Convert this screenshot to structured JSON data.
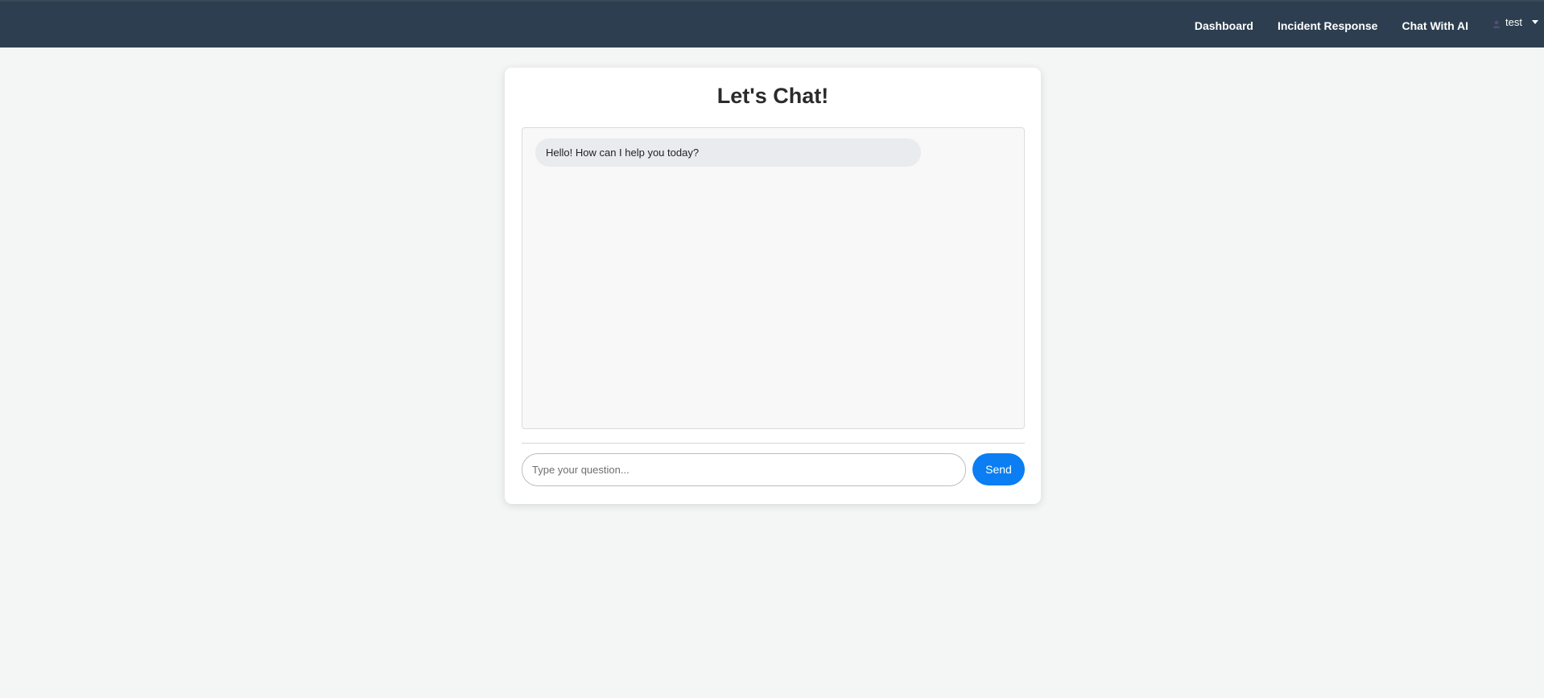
{
  "colors": {
    "navbar_bg": "#2d3e50",
    "page_bg": "#f4f5f5",
    "send_button": "#0a7ef2"
  },
  "nav": {
    "links": [
      {
        "label": "Dashboard"
      },
      {
        "label": "Incident Response"
      },
      {
        "label": "Chat With AI"
      }
    ],
    "user": {
      "icon": "user-icon",
      "name": "test"
    }
  },
  "chat": {
    "title": "Let's Chat!",
    "messages": [
      {
        "sender": "bot",
        "text": "Hello! How can I help you today?"
      }
    ],
    "input": {
      "value": "",
      "placeholder": "Type your question..."
    },
    "send_label": "Send"
  }
}
